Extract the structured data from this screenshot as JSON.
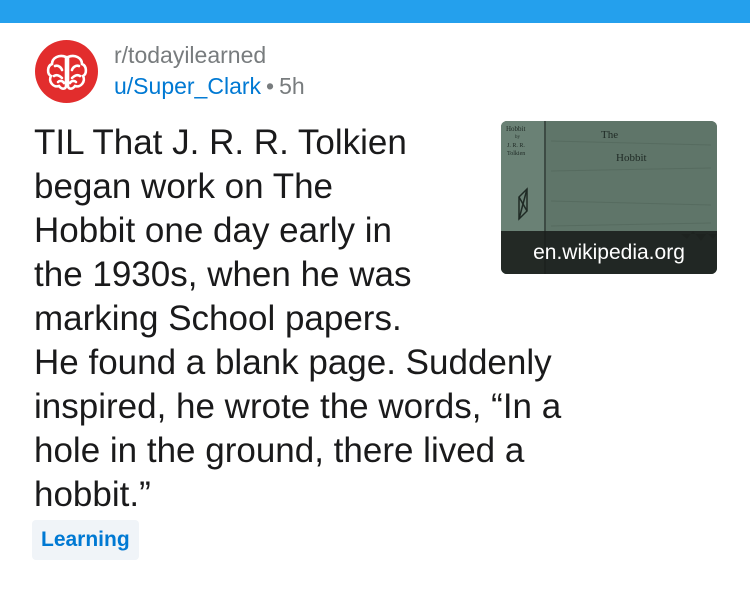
{
  "colors": {
    "top_bar": "#24a0ed",
    "avatar_bg": "#e22d2d",
    "username": "#0079d3",
    "meta_text": "#787c7e",
    "title_text": "#1a1a1b",
    "flair_text": "#0079d3",
    "flair_bg": "#f0f4f8"
  },
  "post": {
    "subreddit": "r/todayilearned",
    "author": "u/Super_Clark",
    "separator": "•",
    "age": "5h",
    "avatar_icon": "brain-icon",
    "title_lines": [
      "TIL That J. R. R. Tolkien",
      "began work on The",
      "Hobbit one day early in",
      "the 1930s, when he was",
      "marking School papers.",
      "He found a blank page. Suddenly",
      "inspired, he wrote the words, “In a",
      "hole in the ground, there lived a",
      "hobbit.”"
    ],
    "thumbnail": {
      "cover_title": "The",
      "cover_subtitle": "Hobbit",
      "spine_lines": [
        "Hobbit",
        "by",
        "J. R. R.",
        "Tolkien"
      ],
      "domain": "en.wikipedia.org"
    },
    "flair": "Learning"
  }
}
